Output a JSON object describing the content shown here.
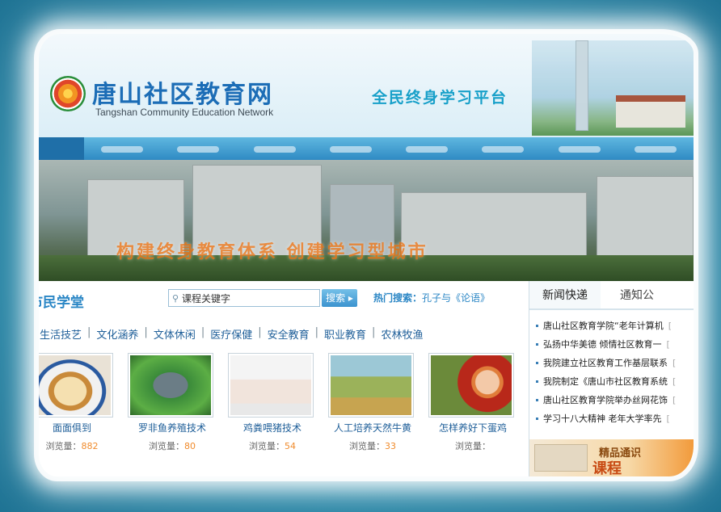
{
  "header": {
    "logo_cn": "唐山社区教育网",
    "logo_en": "Tangshan Community Education Network",
    "slogan": "全民终身学习平台"
  },
  "banner": {
    "text": "构建终身教育体系   创建学习型城市"
  },
  "section": {
    "title": "市民学堂",
    "search_placeholder": "课程关键字",
    "search_button": "搜索",
    "hot_label": "热门搜索：",
    "hot_keyword": "孔子与《论语》"
  },
  "categories": [
    "生活技艺",
    "文化涵养",
    "文体休闲",
    "医疗保健",
    "安全教育",
    "职业教育",
    "农林牧渔"
  ],
  "courses": [
    {
      "name": "面面俱到",
      "views_label": "浏览量：",
      "views": "882"
    },
    {
      "name": "罗非鱼养殖技术",
      "views_label": "浏览量：",
      "views": "80"
    },
    {
      "name": "鸡粪喂猪技术",
      "views_label": "浏览量：",
      "views": "54"
    },
    {
      "name": "人工培养天然牛黄",
      "views_label": "浏览量：",
      "views": "33"
    },
    {
      "name": "怎样养好下蛋鸡",
      "views_label": "浏览量：",
      "views": ""
    }
  ],
  "right": {
    "tab_news": "新闻快递",
    "tab_notice": "通知公",
    "news": [
      {
        "title": "唐山社区教育学院“老年计算机",
        "date": "["
      },
      {
        "title": "弘扬中华美德 倾情社区教育一",
        "date": "["
      },
      {
        "title": "我院建立社区教育工作基层联系",
        "date": "["
      },
      {
        "title": "我院制定《唐山市社区教育系统",
        "date": "["
      },
      {
        "title": "唐山社区教育学院举办丝网花饰",
        "date": "["
      },
      {
        "title": "学习十八大精神 老年大学率先",
        "date": "["
      }
    ],
    "promo_line1": "精品通识",
    "promo_line2": "课程"
  },
  "colors": {
    "accent": "#2a86c5",
    "nav": "#2f8ac4",
    "number": "#f08b2c",
    "background": "#2f8fae"
  }
}
